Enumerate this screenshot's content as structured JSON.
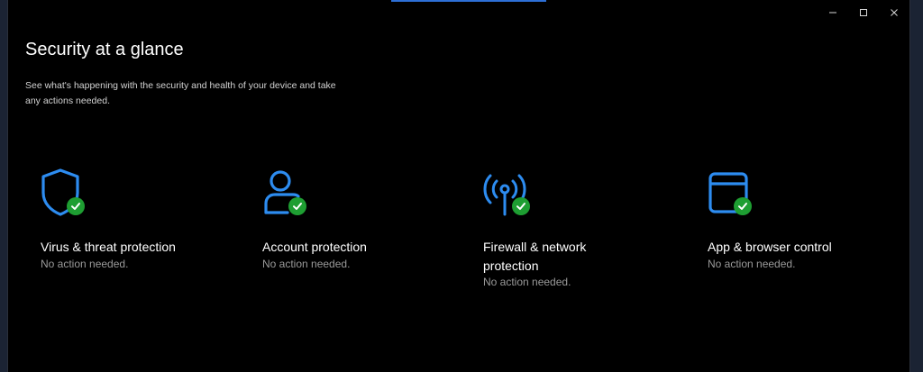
{
  "window": {
    "controls": {
      "minimize_icon": "minimize-icon",
      "maximize_icon": "maximize-icon",
      "close_icon": "close-icon"
    }
  },
  "header": {
    "title": "Security at a glance",
    "subtitle": "See what's happening with the security and health of your device and take any actions needed."
  },
  "cards": [
    {
      "title": "Virus & threat protection",
      "status": "No action needed.",
      "icon": "shield-icon"
    },
    {
      "title": "Account protection",
      "status": "No action needed.",
      "icon": "person-icon"
    },
    {
      "title": "Firewall & network protection",
      "status": "No action needed.",
      "icon": "antenna-icon"
    },
    {
      "title": "App & browser control",
      "status": "No action needed.",
      "icon": "browser-window-icon"
    }
  ],
  "colors": {
    "accent_blue": "#2d8cf0",
    "check_green": "#1e9e32",
    "background": "#000000"
  }
}
